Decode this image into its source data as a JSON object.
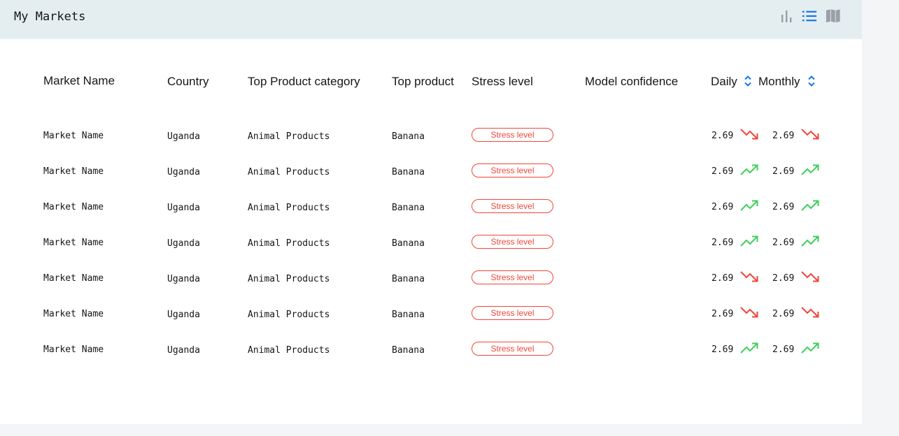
{
  "header": {
    "title": "My Markets",
    "views": [
      {
        "name": "chart-view",
        "icon": "bar-chart-icon",
        "active": false
      },
      {
        "name": "list-view",
        "icon": "list-icon",
        "active": true
      },
      {
        "name": "map-view",
        "icon": "map-icon",
        "active": false
      }
    ]
  },
  "table": {
    "columns": {
      "market_name": "Market Name",
      "country": "Country",
      "category": "Top Product category",
      "product": "Top product",
      "stress": "Stress level",
      "confidence": "Model confidence",
      "daily": "Daily",
      "monthly": "Monthly"
    },
    "rows": [
      {
        "market_name": "Market Name",
        "country": "Uganda",
        "category": "Animal Products",
        "product": "Banana",
        "stress": "Stress level",
        "confidence": "",
        "daily": "2.69",
        "daily_trend": "down",
        "monthly": "2.69",
        "monthly_trend": "down"
      },
      {
        "market_name": "Market Name",
        "country": "Uganda",
        "category": "Animal Products",
        "product": "Banana",
        "stress": "Stress level",
        "confidence": "",
        "daily": "2.69",
        "daily_trend": "up",
        "monthly": "2.69",
        "monthly_trend": "up"
      },
      {
        "market_name": "Market Name",
        "country": "Uganda",
        "category": "Animal Products",
        "product": "Banana",
        "stress": "Stress level",
        "confidence": "",
        "daily": "2.69",
        "daily_trend": "up",
        "monthly": "2.69",
        "monthly_trend": "up"
      },
      {
        "market_name": "Market Name",
        "country": "Uganda",
        "category": "Animal Products",
        "product": "Banana",
        "stress": "Stress level",
        "confidence": "",
        "daily": "2.69",
        "daily_trend": "up",
        "monthly": "2.69",
        "monthly_trend": "up"
      },
      {
        "market_name": "Market Name",
        "country": "Uganda",
        "category": "Animal Products",
        "product": "Banana",
        "stress": "Stress level",
        "confidence": "",
        "daily": "2.69",
        "daily_trend": "down",
        "monthly": "2.69",
        "monthly_trend": "down"
      },
      {
        "market_name": "Market Name",
        "country": "Uganda",
        "category": "Animal Products",
        "product": "Banana",
        "stress": "Stress level",
        "confidence": "",
        "daily": "2.69",
        "daily_trend": "down",
        "monthly": "2.69",
        "monthly_trend": "down"
      },
      {
        "market_name": "Market Name",
        "country": "Uganda",
        "category": "Animal Products",
        "product": "Banana",
        "stress": "Stress level",
        "confidence": "",
        "daily": "2.69",
        "daily_trend": "up",
        "monthly": "2.69",
        "monthly_trend": "up"
      }
    ]
  },
  "colors": {
    "header_bg": "#e4eef1",
    "accent_blue": "#1a73e8",
    "stress_red": "#f0453a",
    "trend_up": "#3ecf5a",
    "trend_down": "#f0453a",
    "icon_gray": "#9aa0a6"
  }
}
